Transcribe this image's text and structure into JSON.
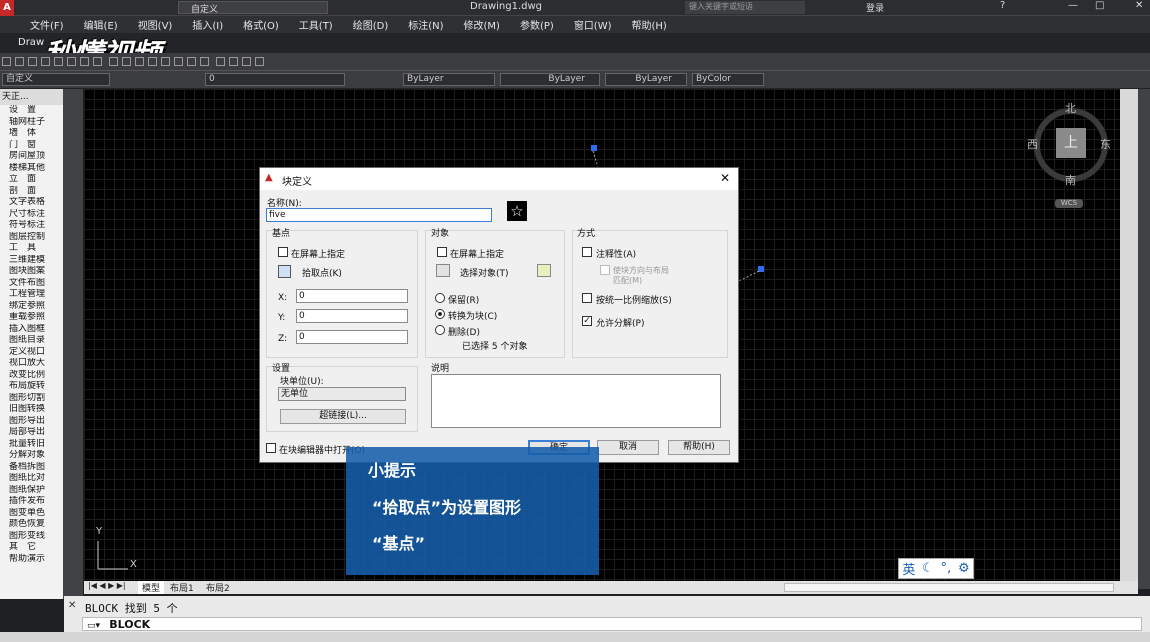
{
  "window": {
    "title": "Drawing1.dwg",
    "workspace": "自定义",
    "search_placeholder": "键入关键字或短语",
    "login": "登录"
  },
  "menu": [
    "文件(F)",
    "编辑(E)",
    "视图(V)",
    "插入(I)",
    "格式(O)",
    "工具(T)",
    "绘图(D)",
    "标注(N)",
    "修改(M)",
    "参数(P)",
    "窗口(W)",
    "帮助(H)"
  ],
  "tab": {
    "label": "Draw"
  },
  "watermark": "秒懂视频",
  "layer_bar": {
    "workspace": "自定义",
    "layer": "0",
    "color": "ByLayer",
    "linetype": "ByLayer",
    "lineweight": "ByLayer",
    "plotstyle": "ByColor"
  },
  "left_panel": {
    "header": "天正...",
    "items": [
      "设　置",
      "轴网柱子",
      "墙　体",
      "门　窗",
      "房间屋顶",
      "楼梯其他",
      "立　面",
      "剖　面",
      "文字表格",
      "尺寸标注",
      "符号标注",
      "图层控制",
      "工　具",
      "三维建模",
      "图块图案",
      "文件布图",
      "工程管理",
      "绑定参照",
      "重载参照",
      "插入图框",
      "图纸目录",
      "定义视口",
      "视口放大",
      "改变比例",
      "布局旋转",
      "图形切割",
      "旧图转换",
      "图形导出",
      "局部导出",
      "批量转旧",
      "分解对象",
      "备档拆图",
      "图纸比对",
      "图纸保护",
      "插件发布",
      "图变单色",
      "颜色恢复",
      "图形变线",
      "其　它",
      "帮助演示"
    ]
  },
  "viewcube": {
    "north": "北",
    "south": "南",
    "east": "东",
    "west": "西",
    "top": "上",
    "ucs": "WCS"
  },
  "dialog": {
    "title": "块定义",
    "name_label": "名称(N):",
    "name_value": "five",
    "basepoint": {
      "title": "基点",
      "onscreen": "在屏幕上指定",
      "pick": "拾取点(K)",
      "x_label": "X:",
      "x": "0",
      "y_label": "Y:",
      "y": "0",
      "z_label": "Z:",
      "z": "0"
    },
    "objects": {
      "title": "对象",
      "onscreen": "在屏幕上指定",
      "select": "选择对象(T)",
      "retain": "保留(R)",
      "convert": "转换为块(C)",
      "delete": "删除(D)",
      "count": "已选择 5 个对象"
    },
    "behavior": {
      "title": "方式",
      "annotative": "注释性(A)",
      "match": "使块方向与布局",
      "match2": "匹配(M)",
      "uniform": "按统一比例缩放(S)",
      "explode": "允许分解(P)"
    },
    "settings": {
      "title": "设置",
      "unit_label": "块单位(U):",
      "unit_value": "无单位",
      "hyperlink": "超链接(L)..."
    },
    "description": {
      "title": "说明"
    },
    "open_editor": "在块编辑器中打开(O)",
    "ok": "确定",
    "cancel": "取消",
    "help": "帮助(H)"
  },
  "tip": {
    "title": "小提示",
    "line1": "“拾取点”为设置图形",
    "line2": "“基点”"
  },
  "layout_tabs": [
    "模型",
    "布局1",
    "布局2"
  ],
  "command": {
    "history": "BLOCK 找到 5 个",
    "current": "BLOCK"
  },
  "ime": {
    "lang": "英"
  }
}
